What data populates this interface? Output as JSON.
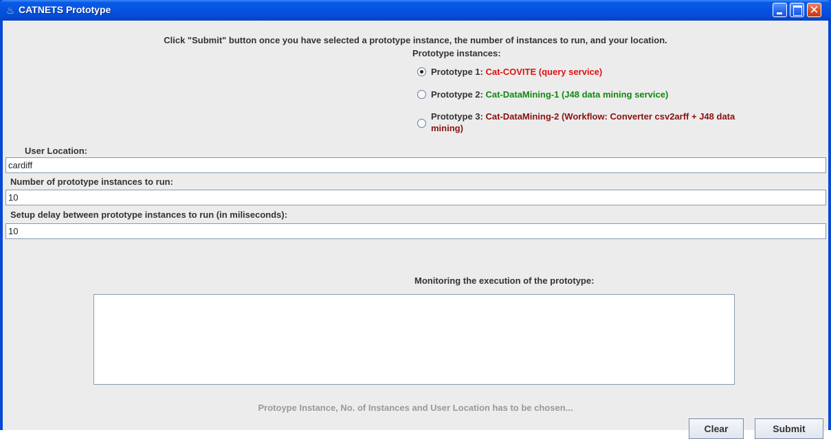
{
  "window": {
    "title": "CATNETS Prototype",
    "icon": "java-cup-icon",
    "controls": [
      "minimize-icon",
      "maximize-icon",
      "close-icon"
    ],
    "close_glyph": "✕"
  },
  "instruction": "Click \"Submit\" button once you have selected a prototype instance, the number of instances to run, and your location.",
  "prototypes": {
    "header": "Prototype instances:",
    "selected_index": 0,
    "items": [
      {
        "prefix": "Prototype 1: ",
        "name": "Cat-COVITE (query service)",
        "color": "#dd1111"
      },
      {
        "prefix": "Prototype 2: ",
        "name": "Cat-DataMining-1 (J48 data mining service)",
        "color": "#0e8a0e"
      },
      {
        "prefix": "Prototype 3: ",
        "name_line1": "Cat-DataMining-2 (Workflow: Converter csv2arff + J48 data",
        "name_line2": "mining)",
        "color": "#8a1010"
      }
    ]
  },
  "fields": {
    "location": {
      "label": "User Location:",
      "value": "cardiff"
    },
    "instances": {
      "label": "Number of prototype instances to run:",
      "value": "10"
    },
    "delay": {
      "label": "Setup delay between prototype instances to run (in miliseconds):",
      "value": "10"
    }
  },
  "monitor": {
    "label": "Monitoring the execution of the prototype:",
    "content": ""
  },
  "status": "Protoype Instance, No. of Instances and User Location has to be chosen...",
  "buttons": {
    "clear": "Clear",
    "submit": "Submit"
  }
}
